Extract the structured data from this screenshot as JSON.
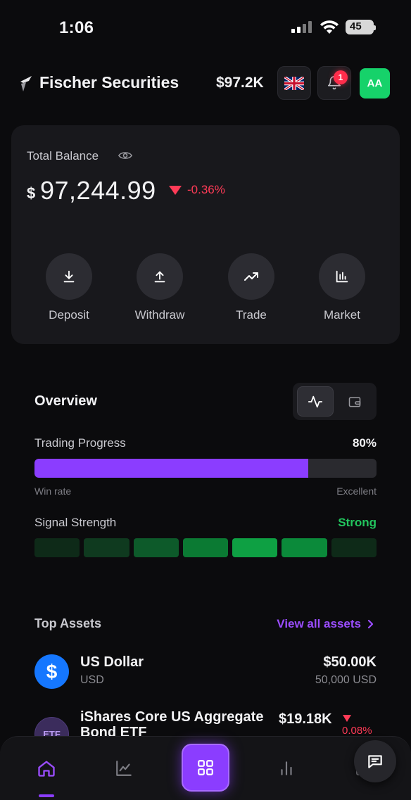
{
  "status_bar": {
    "time": "1:06",
    "battery": "45"
  },
  "header": {
    "brand": "Fischer Securities",
    "balance": "$97.2K",
    "notification_count": "1",
    "avatar_initials": "AA"
  },
  "balance_card": {
    "label": "Total Balance",
    "currency_symbol": "$",
    "amount": "97,244.99",
    "change": "-0.36%",
    "change_direction": "down",
    "actions": [
      {
        "label": "Deposit",
        "icon": "download-icon"
      },
      {
        "label": "Withdraw",
        "icon": "upload-icon"
      },
      {
        "label": "Trade",
        "icon": "trending-up-icon"
      },
      {
        "label": "Market",
        "icon": "bar-chart-icon"
      }
    ]
  },
  "overview": {
    "title": "Overview",
    "trading_progress": {
      "label": "Trading Progress",
      "value": "80%",
      "fraction": 0.8,
      "left_caption": "Win rate",
      "right_caption": "Excellent"
    },
    "signal_strength": {
      "label": "Signal Strength",
      "value": "Strong",
      "blocks": [
        "#0e2a18",
        "#0f3a1f",
        "#0d5a2a",
        "#0b7a33",
        "#0ea043",
        "#0b8a3a",
        "#0e2a18"
      ]
    }
  },
  "top_assets": {
    "title": "Top Assets",
    "view_all": "View all assets",
    "items": [
      {
        "name": "US Dollar",
        "sub": "USD",
        "value": "$50.00K",
        "quantity": "50,000 USD",
        "icon_text": "$"
      },
      {
        "name": "iShares Core US Aggregate Bond ETF",
        "icon_text": "ETF",
        "value": "$19.18K",
        "change": "0.08%"
      }
    ]
  },
  "colors": {
    "accent": "#8b3dff",
    "negative": "#ff3b57",
    "positive": "#22c55e",
    "avatar": "#16d26a"
  }
}
